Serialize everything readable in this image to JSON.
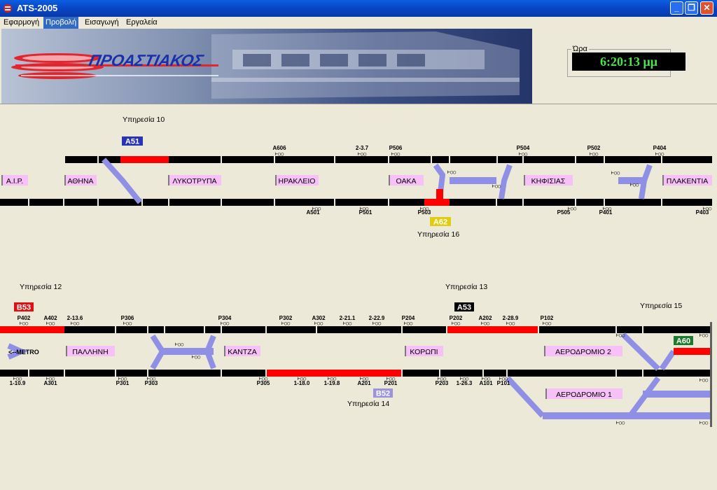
{
  "window": {
    "title": "ATS-2005",
    "buttons": {
      "minimize": "_",
      "restore": "❐",
      "close": "✕"
    }
  },
  "menu": {
    "items": [
      "Εφαρμογή",
      "Προβολή",
      "Εισαγωγή",
      "Εργαλεία"
    ],
    "active_index": 1
  },
  "banner": {
    "logo_text": "ΠΡΟΑΣΤΙΑΚΟΣ"
  },
  "clock": {
    "label": "Ώρα",
    "time": "6:20:13 μμ"
  },
  "colors": {
    "track": "#8f8fe6",
    "occupied": "#ff0000",
    "station_fill": "#f7c0f7",
    "train_blue": "#2833b8",
    "train_red": "#e01010",
    "train_yellow": "#e0cc10",
    "train_black": "#000000",
    "train_lilac": "#9c92e0",
    "train_green": "#1c7a2a"
  },
  "services": [
    {
      "text": "Υπηρεσία 10"
    },
    {
      "text": "Υπηρεσία 16"
    },
    {
      "text": "Υπηρεσία 12"
    },
    {
      "text": "Υπηρεσία 13"
    },
    {
      "text": "Υπηρεσία 15"
    },
    {
      "text": "Υπηρεσία 14"
    }
  ],
  "trains": [
    {
      "id": "A51",
      "color": "train_blue"
    },
    {
      "id": "A62",
      "color": "train_yellow"
    },
    {
      "id": "B53",
      "color": "train_red"
    },
    {
      "id": "A53",
      "color": "train_black"
    },
    {
      "id": "A60",
      "color": "train_green"
    },
    {
      "id": "B52",
      "color": "train_lilac"
    }
  ],
  "stations": [
    {
      "name": "Α.Ι.Ρ."
    },
    {
      "name": "ΑΘΗΝΑ"
    },
    {
      "name": "ΛΥΚΟΤΡΥΠΑ"
    },
    {
      "name": "ΗΡΑΚΛΕΙΟ"
    },
    {
      "name": "ΟΑΚΑ"
    },
    {
      "name": "ΚΗΦΙΣΙΑΣ"
    },
    {
      "name": "ΠΛΑΚΕΝΤΙΑ"
    },
    {
      "name": "ΠΑΛΛΗΝΗ"
    },
    {
      "name": "ΚΑΝΤΖΑ"
    },
    {
      "name": "ΚΟΡΩΠΙ"
    },
    {
      "name": "ΑΕΡΟΔΡΟΜΙΟ 2"
    },
    {
      "name": "ΑΕΡΟΔΡΟΜΙΟ 1"
    }
  ],
  "metro_label": "<--METRO",
  "signals": [
    {
      "label": "A606"
    },
    {
      "label": "2-3.7"
    },
    {
      "label": "P506"
    },
    {
      "label": "P504"
    },
    {
      "label": "P502"
    },
    {
      "label": "P404"
    },
    {
      "label": "A501"
    },
    {
      "label": "P501"
    },
    {
      "label": "P503"
    },
    {
      "label": "P505"
    },
    {
      "label": "P401"
    },
    {
      "label": "P403"
    },
    {
      "label": "P402"
    },
    {
      "label": "A402"
    },
    {
      "label": "2-13.6"
    },
    {
      "label": "P306"
    },
    {
      "label": "P304"
    },
    {
      "label": "P302"
    },
    {
      "label": "A302"
    },
    {
      "label": "2-21.1"
    },
    {
      "label": "2-22.9"
    },
    {
      "label": "P204"
    },
    {
      "label": "P202"
    },
    {
      "label": "A202"
    },
    {
      "label": "2-28.9"
    },
    {
      "label": "P102"
    },
    {
      "label": "1-10.9"
    },
    {
      "label": "A301"
    },
    {
      "label": "P301"
    },
    {
      "label": "P303"
    },
    {
      "label": "P305"
    },
    {
      "label": "1-18.0"
    },
    {
      "label": "1-19.8"
    },
    {
      "label": "A201"
    },
    {
      "label": "P201"
    },
    {
      "label": "P203"
    },
    {
      "label": "1-26.3"
    },
    {
      "label": "A101"
    },
    {
      "label": "P101"
    }
  ]
}
